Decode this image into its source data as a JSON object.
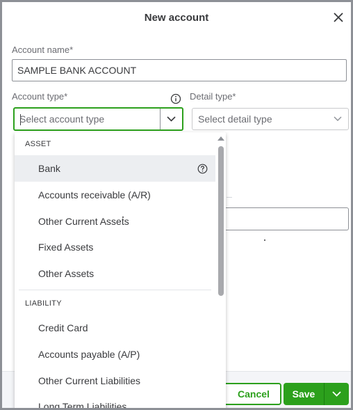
{
  "dialog": {
    "title": "New account"
  },
  "form": {
    "account_name_label": "Account name*",
    "account_name_value": "SAMPLE BANK ACCOUNT",
    "account_type_label": "Account type*",
    "account_type_placeholder": "Select account type",
    "detail_type_label": "Detail type*",
    "detail_type_placeholder": "Select detail type"
  },
  "dropdown": {
    "groups": [
      {
        "heading": "ASSET",
        "options": [
          "Bank",
          "Accounts receivable (A/R)",
          "Other Current Assets",
          "Fixed Assets",
          "Other Assets"
        ]
      },
      {
        "heading": "LIABILITY",
        "options": [
          "Credit Card",
          "Accounts payable (A/P)",
          "Other Current Liabilities",
          "Long Term Liabilities"
        ]
      }
    ]
  },
  "footer": {
    "cancel_label": "Cancel",
    "save_label": "Save"
  },
  "colors": {
    "accent_green": "#2ca01c",
    "text": "#393a3d",
    "muted": "#6b6c72",
    "highlight": "#eceef1"
  },
  "icons": [
    "close-icon",
    "info-icon",
    "chevron-down-icon",
    "help-icon",
    "scroll-up-arrow-icon"
  ]
}
